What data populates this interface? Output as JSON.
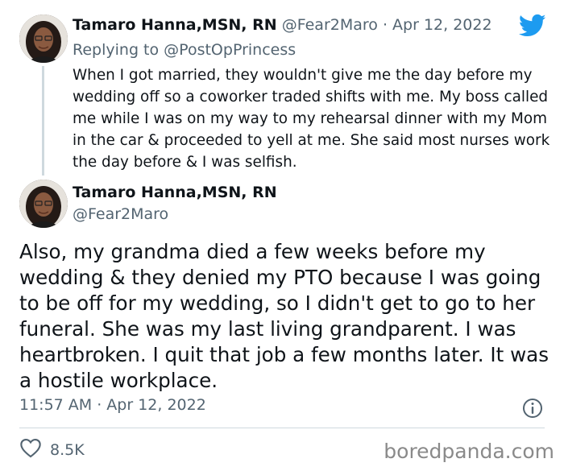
{
  "reply_tweet": {
    "author_name": "Tamaro Hanna,MSN, RN",
    "author_handle": "@Fear2Maro",
    "separator": "·",
    "date": "Apr 12, 2022",
    "replying_prefix": "Replying to",
    "replying_handle": "@PostOpPrincess",
    "text": "When I got married, they wouldn't give me the day before my wedding off so a coworker traded shifts with me. My boss called me while I was on my way to my rehearsal dinner with my Mom in the car & proceeded to yell at me. She said most nurses work the day before & I was selfish."
  },
  "main_tweet": {
    "author_name": "Tamaro Hanna,MSN, RN",
    "author_handle": "@Fear2Maro",
    "text": "Also, my grandma died a few weeks before my wedding & they denied my PTO because I was going to be off for my wedding, so I didn't get to go to her funeral. She was my last living grandparent. I was heartbroken. I quit that job a few months later. It was a hostile workplace.",
    "timestamp": "11:57 AM · Apr 12, 2022",
    "like_count": "8.5K"
  },
  "watermark": "boredpanda.com",
  "icons": {
    "brand": "twitter-bird-icon",
    "info": "info-icon",
    "like": "heart-icon"
  },
  "colors": {
    "twitter_blue": "#1d9bf0",
    "text": "#0f1419",
    "secondary": "#536471",
    "divider": "#cfd9de"
  }
}
